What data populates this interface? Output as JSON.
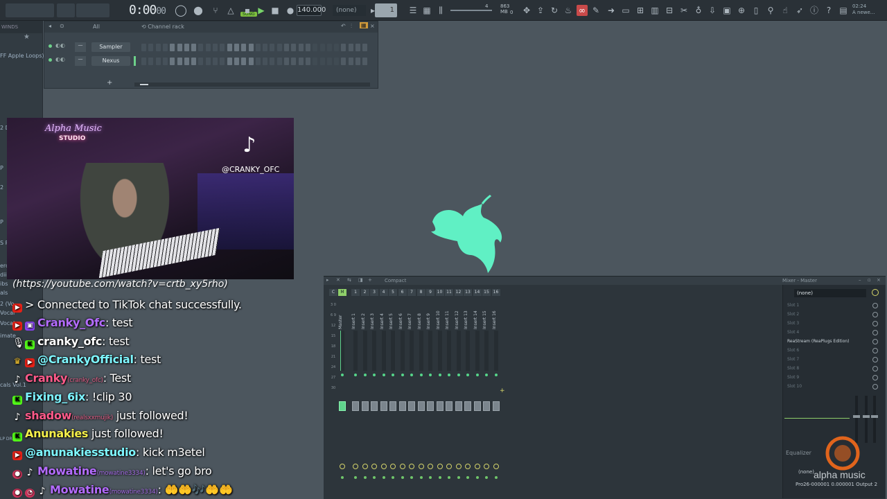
{
  "toolbar": {
    "time_main": "0:00",
    "time_sub": "00",
    "bpm": "140.000",
    "pattern": "(none)",
    "song_tag": "SONG",
    "pattern_number": "1",
    "cpu_mem": "863 MB",
    "cpu_voices": "0",
    "cpu_count": "4",
    "hint_date": "02:24",
    "hint_text": "A newe..."
  },
  "browser": {
    "header": "WINDS",
    "items": [
      "FF Apple Loops)",
      "2 D",
      "P",
      "2",
      "P",
      "S P",
      "ercu",
      "dii",
      "ibs",
      "als",
      "2 (Vo",
      "Vocal",
      "Vocal",
      "imate",
      "cals Vol.1",
      "LP DRUMS"
    ]
  },
  "channel_rack": {
    "filter": "All",
    "title": "Channel rack",
    "channels": [
      {
        "name": "Sampler"
      },
      {
        "name": "Nexus"
      }
    ]
  },
  "overlay": {
    "neon_line1": "Alpha Music",
    "neon_line2": "STUDIO",
    "tiktok_handle": "@CRANKY_OFC",
    "url": "(https://youtube.com/watch?v=crtb_xy5rho)"
  },
  "chat": [
    {
      "badges": [
        "yt"
      ],
      "user": "",
      "user_color": "#ffffff",
      "sub": "",
      "text": "> Connected to TikTok chat successfully."
    },
    {
      "badges": [
        "yt",
        "tw"
      ],
      "user": "Cranky_Ofc",
      "user_color": "#b46cff",
      "sub": "",
      "text": ": test"
    },
    {
      "badges": [
        "mic",
        "kk"
      ],
      "user": "cranky_ofc",
      "user_color": "#ffffff",
      "sub": "",
      "text": ": test"
    },
    {
      "badges": [
        "crown",
        "yt"
      ],
      "user": "@CrankyOfficial",
      "user_color": "#7ef6ff",
      "sub": "",
      "text": ": test"
    },
    {
      "badges": [
        "tt"
      ],
      "user": "Cranky",
      "user_color": "#ff5a8a",
      "sub": "(cranky_ofc)",
      "text": ": Test"
    },
    {
      "badges": [
        "kk"
      ],
      "user": "Fixing_6ix",
      "user_color": "#7df3ff",
      "sub": "",
      "text": ": !clip 30"
    },
    {
      "badges": [
        "tt"
      ],
      "user": "shadow",
      "user_color": "#ff5a8a",
      "sub": "(realsxxmujik)",
      "text": " just followed!"
    },
    {
      "badges": [
        "kk"
      ],
      "user": "Anunakies",
      "user_color": "#f5f04a",
      "sub": "",
      "text": " just followed!"
    },
    {
      "badges": [
        "yt"
      ],
      "user": "@anunakiesstudio",
      "user_color": "#7ef6ff",
      "sub": "",
      "text": ": kick m3etel"
    },
    {
      "badges": [
        "mod",
        "tt"
      ],
      "user": "Mowatine",
      "user_color": "#b46cff",
      "sub": "(mowatine3334)",
      "text": ": let's go bro"
    },
    {
      "badges": [
        "mod",
        "clock",
        "tt"
      ],
      "user": "Mowatine",
      "user_color": "#b46cff",
      "sub": "(mowatine3334)",
      "text": ": 🤲🤲🎶🤲🤲"
    }
  ],
  "mixer": {
    "view": "Compact",
    "title": "Mixer - Master",
    "master_label": "Master",
    "insert_labels": [
      "Insert 1",
      "Insert 2",
      "Insert 3",
      "Insert 4",
      "Insert 5",
      "Insert 6",
      "Insert 7",
      "Insert 8",
      "Insert 9",
      "Insert 10",
      "Insert 11",
      "Insert 12",
      "Insert 13",
      "Insert 14",
      "Insert 15",
      "Insert 16"
    ],
    "track_numbers": [
      "C",
      "M",
      "1",
      "2",
      "3",
      "4",
      "5",
      "6",
      "7",
      "8",
      "9",
      "10",
      "11",
      "12",
      "13",
      "14",
      "15",
      "16"
    ],
    "preset": "(none)",
    "slots": [
      "Slot 1",
      "Slot 2",
      "Slot 3",
      "Slot 4",
      "ReaStream (ReaPlugs Edition)",
      "Slot 6",
      "Slot 7",
      "Slot 8",
      "Slot 9",
      "Slot 10"
    ],
    "eq_label": "Equalizer",
    "out_none": "(none)",
    "output": "Pro26-000001 0.000001 Output 2"
  },
  "watermark": "alpha music"
}
